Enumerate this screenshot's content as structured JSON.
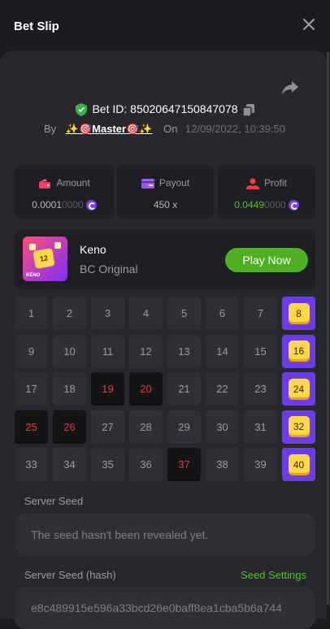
{
  "header": {
    "title": "Bet Slip"
  },
  "bet": {
    "id_text": "Bet ID: 85020647150847078",
    "by_label": "By",
    "user": "✨🎯Master🎯✨",
    "on_label": "On",
    "datetime": "12/09/2022, 10:39:50"
  },
  "stats": {
    "amount": {
      "label": "Amount",
      "value_main": "0.0001",
      "value_dim": "0000"
    },
    "payout": {
      "label": "Payout",
      "value": "450 x"
    },
    "profit": {
      "label": "Profit",
      "value_main": "0.0449",
      "value_dim": "0000"
    }
  },
  "game": {
    "name": "Keno",
    "subtitle": "BC Original",
    "thumb_number": "12",
    "thumb_label": "KENO",
    "play_label": "Play Now"
  },
  "grid": {
    "numbers": [
      "1",
      "2",
      "3",
      "4",
      "5",
      "6",
      "7",
      "8",
      "9",
      "10",
      "11",
      "12",
      "13",
      "14",
      "15",
      "16",
      "17",
      "18",
      "19",
      "20",
      "21",
      "22",
      "23",
      "24",
      "25",
      "26",
      "27",
      "28",
      "29",
      "30",
      "31",
      "32",
      "33",
      "34",
      "35",
      "36",
      "37",
      "38",
      "39",
      "40"
    ],
    "red": [
      "19",
      "20",
      "25",
      "26",
      "37"
    ],
    "hits": [
      "8",
      "16",
      "24",
      "32",
      "40"
    ]
  },
  "server_seed": {
    "label": "Server Seed",
    "value": "The seed hasn't been revealed yet."
  },
  "server_seed_hash": {
    "label": "Server Seed (hash)",
    "settings_label": "Seed Settings",
    "value": "e8c489915e596a33bcd26e0baff8ea1cba5b6a744"
  },
  "colors": {
    "accent_green": "#4fae22",
    "hit_purple": "#6b3cf0",
    "hit_yellow": "#ffd84a",
    "miss_red": "#e23b3b"
  }
}
